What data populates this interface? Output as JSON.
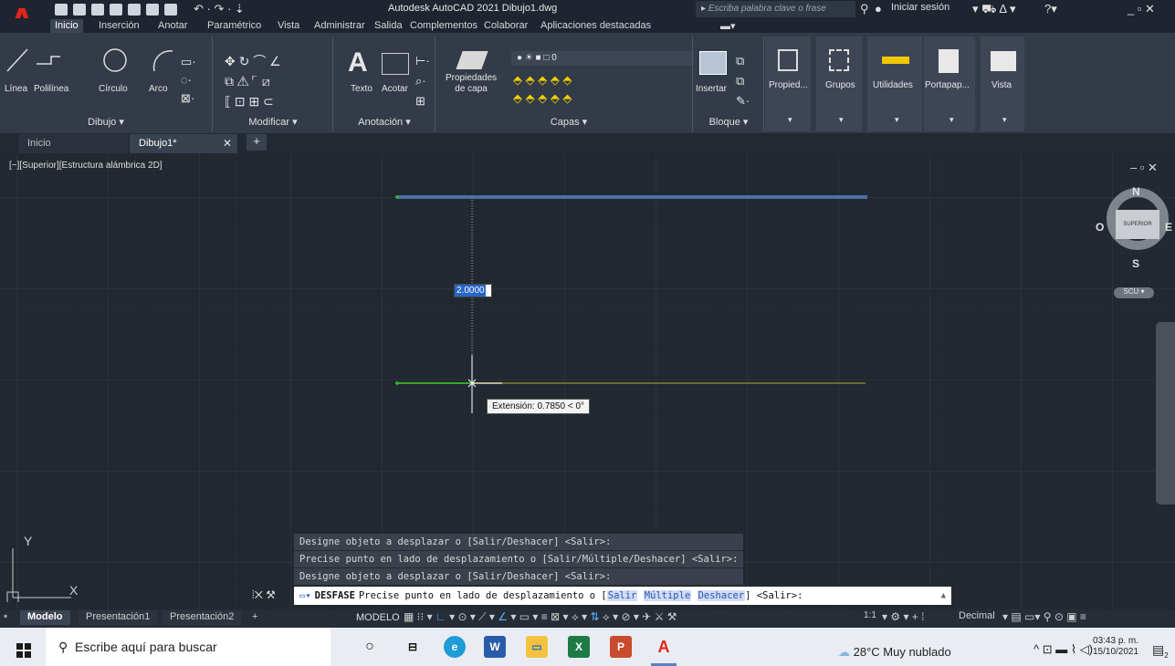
{
  "app": {
    "title": "Autodesk AutoCAD 2021   Dibujo1.dwg",
    "logo_letter": "A",
    "search_placeholder": "Escriba palabra clave o frase",
    "signin_label": "Iniciar sesión"
  },
  "ribbon_tabs": [
    "Inicio",
    "Inserción",
    "Anotar",
    "Paramétrico",
    "Vista",
    "Administrar",
    "Salida",
    "Complementos",
    "Colaborar",
    "Aplicaciones destacadas"
  ],
  "ribbon": {
    "draw_tools": [
      "Línea",
      "Polilínea",
      "Círculo",
      "Arco"
    ],
    "text_label": "Texto",
    "dim_label": "Acotar",
    "props_label": "Propiedades\nde capa",
    "layer_name": "0",
    "insert_label": "Insertar",
    "right_tools": [
      "Propied...",
      "Grupos",
      "Utilidades",
      "Portapap...",
      "Vista"
    ],
    "panels": [
      "Dibujo ▾",
      "Modificar ▾",
      "Anotación ▾",
      "Capas ▾",
      "Bloque ▾"
    ]
  },
  "doc_tabs": {
    "home": "Inicio",
    "current": "Dibujo1*"
  },
  "viewport": {
    "label": "[−][Superior][Estructura alámbrica 2D]",
    "dim_input": "2.0000",
    "tooltip": "Extensión: 0.7850 < 0°",
    "viewcube_face": "SUPERIOR",
    "compass": {
      "n": "N",
      "s": "S",
      "e": "E",
      "w": "O"
    },
    "ucs_label": "SCU",
    "axis_x": "X",
    "axis_y": "Y"
  },
  "command": {
    "history": [
      "Designe objeto a desplazar o [Salir/Deshacer] <Salir>:",
      "Precise punto en lado de desplazamiento o [Salir/Múltiple/Deshacer] <Salir>:",
      "Designe objeto a desplazar o [Salir/Deshacer] <Salir>:"
    ],
    "name": "DESFASE",
    "prompt": "Precise punto en lado de desplazamiento o [",
    "opt1": "Salir",
    "opt2": "Múltiple",
    "opt3": "Deshacer",
    "suffix": "] <Salir>:"
  },
  "layout_tabs": [
    "Modelo",
    "Presentación1",
    "Presentación2"
  ],
  "status": {
    "space": "MODELO",
    "scale": "1:1",
    "units": "Decimal"
  },
  "taskbar": {
    "search": "Escribe aquí para buscar",
    "weather": "28°C  Muy nublado",
    "time": "03:43 p. m.",
    "date": "15/10/2021",
    "notif_count": "2"
  },
  "colors": {
    "accent": "#2765c8",
    "line_blue": "#4a6fa5",
    "line_olive": "#6b6a2e",
    "grip_green": "#2fb52f"
  }
}
